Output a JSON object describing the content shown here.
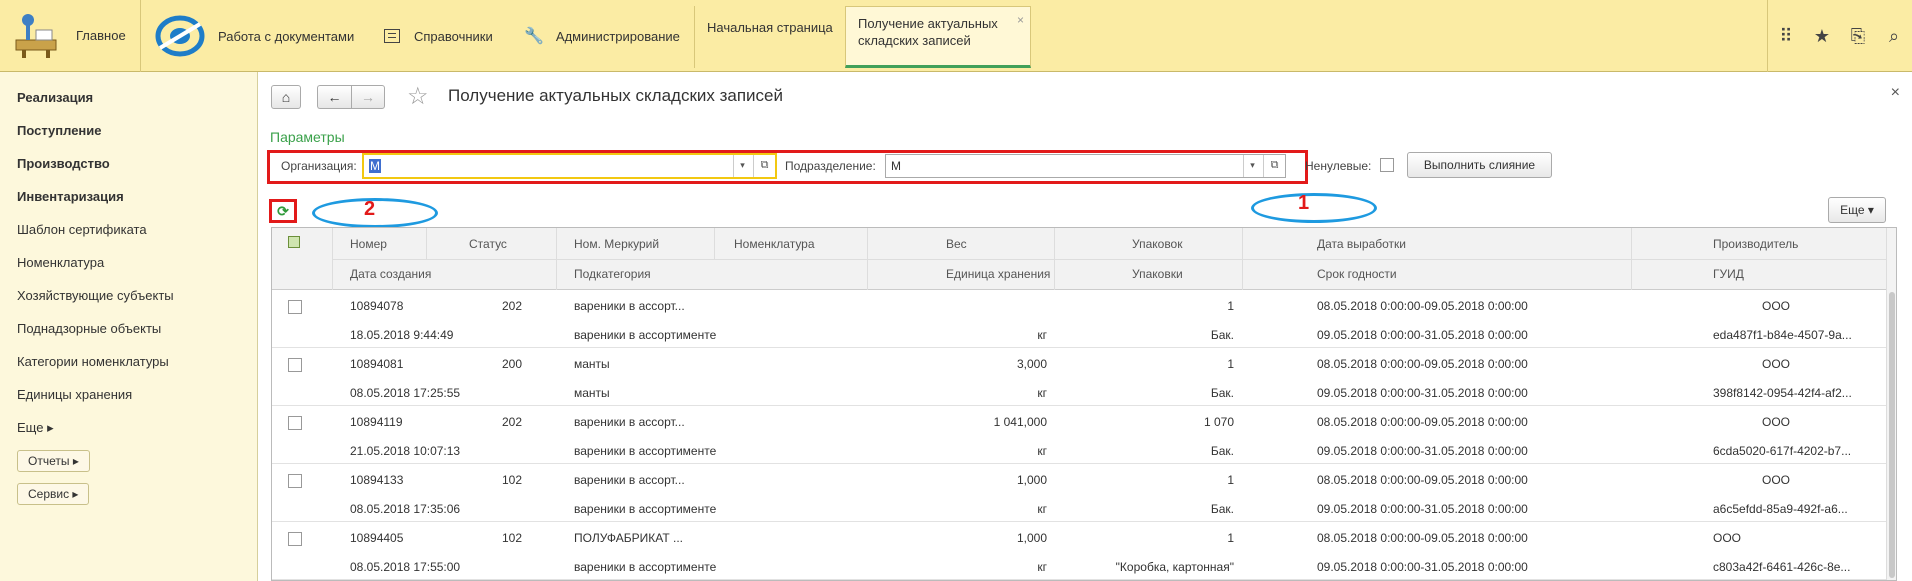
{
  "topbar": {
    "home_label": "Главное",
    "sections": [
      {
        "label": "Работа с документами",
        "icon": "docs-icon"
      },
      {
        "label": "Справочники",
        "icon": "list-icon"
      },
      {
        "label": "Администрирование",
        "icon": "wrench-icon"
      }
    ],
    "tabs": [
      {
        "label": "Начальная страница"
      },
      {
        "label": "Получение актуальных складских записей"
      }
    ],
    "right_icons": [
      "grid-icon",
      "star-icon",
      "history-icon",
      "search-icon"
    ]
  },
  "sidebar": {
    "items_bold": [
      "Реализация",
      "Поступление",
      "Производство",
      "Инвентаризация"
    ],
    "items": [
      "Шаблон сертификата",
      "Номенклатура",
      "Хозяйствующие субъекты",
      "Поднадзорные объекты",
      "Категории номенклатуры",
      "Единицы хранения"
    ],
    "more_label": "Еще ▸",
    "buttons": [
      "Отчеты ▸",
      "Сервис ▸"
    ]
  },
  "main": {
    "title": "Получение актуальных складских записей",
    "params_link": "Параметры",
    "org_label": "Организация:",
    "org_value": "М",
    "dept_label": "Подразделение:",
    "dept_value": "М",
    "nonzero_label": "Ненулевые:",
    "merge_button": "Выполнить слияние",
    "more_button": "Еще ▾",
    "annotation_1": "1",
    "annotation_2": "2"
  },
  "table": {
    "headers_row1": [
      "Номер",
      "Статус",
      "Ном. Меркурий",
      "Номенклатура",
      "Вес",
      "Упаковок",
      "Дата выработки",
      "Производитель"
    ],
    "headers_row2": [
      "Дата создания",
      "Подкатегория",
      "Единица хранения",
      "Упаковки",
      "Срок годности",
      "ГУИД"
    ],
    "rows": [
      {
        "num": "10894078",
        "status": "202",
        "merc": "вареники в ассорт...",
        "weight": "",
        "packs": "1",
        "prod_date": "08.05.2018 0:00:00-09.05.2018 0:00:00",
        "producer": "ООО",
        "created": "18.05.2018 9:44:49",
        "subcat": "вареники в ассортименте",
        "unit": "кг",
        "pack_type": "Бак.",
        "expiry": "09.05.2018 0:00:00-31.05.2018 0:00:00",
        "guid": "eda487f1-b84e-4507-9a..."
      },
      {
        "num": "10894081",
        "status": "200",
        "merc": "манты",
        "weight": "3,000",
        "packs": "1",
        "prod_date": "08.05.2018 0:00:00-09.05.2018 0:00:00",
        "producer": "ООО",
        "created": "08.05.2018 17:25:55",
        "subcat": "манты",
        "unit": "кг",
        "pack_type": "Бак.",
        "expiry": "09.05.2018 0:00:00-31.05.2018 0:00:00",
        "guid": "398f8142-0954-42f4-af2..."
      },
      {
        "num": "10894119",
        "status": "202",
        "merc": "вареники в ассорт...",
        "weight": "1 041,000",
        "packs": "1 070",
        "prod_date": "08.05.2018 0:00:00-09.05.2018 0:00:00",
        "producer": "ООО",
        "created": "21.05.2018 10:07:13",
        "subcat": "вареники в ассортименте",
        "unit": "кг",
        "pack_type": "Бак.",
        "expiry": "09.05.2018 0:00:00-31.05.2018 0:00:00",
        "guid": "6cda5020-617f-4202-b7..."
      },
      {
        "num": "10894133",
        "status": "102",
        "merc": "вареники в ассорт...",
        "weight": "1,000",
        "packs": "1",
        "prod_date": "08.05.2018 0:00:00-09.05.2018 0:00:00",
        "producer": "ООО",
        "created": "08.05.2018 17:35:06",
        "subcat": "вареники в ассортименте",
        "unit": "кг",
        "pack_type": "Бак.",
        "expiry": "09.05.2018 0:00:00-31.05.2018 0:00:00",
        "guid": "a6c5efdd-85a9-492f-a6..."
      },
      {
        "num": "10894405",
        "status": "102",
        "merc": "ПОЛУФАБРИКАТ ...",
        "weight": "1,000",
        "packs": "1",
        "prod_date": "08.05.2018 0:00:00-09.05.2018 0:00:00",
        "producer": "ООО",
        "created": "08.05.2018 17:55:00",
        "subcat": "вареники в ассортименте",
        "unit": "кг",
        "pack_type": "\"Коробка, картонная\"",
        "expiry": "09.05.2018 0:00:00-31.05.2018 0:00:00",
        "guid": "c803a42f-6461-426c-8e..."
      }
    ]
  },
  "colors": {
    "topbar": "#fbeca4",
    "sidebar": "#fdf8dc",
    "annotation_red": "#e21a1a",
    "annotation_blue": "#1e9ae0",
    "link_green": "#3aa14a"
  }
}
